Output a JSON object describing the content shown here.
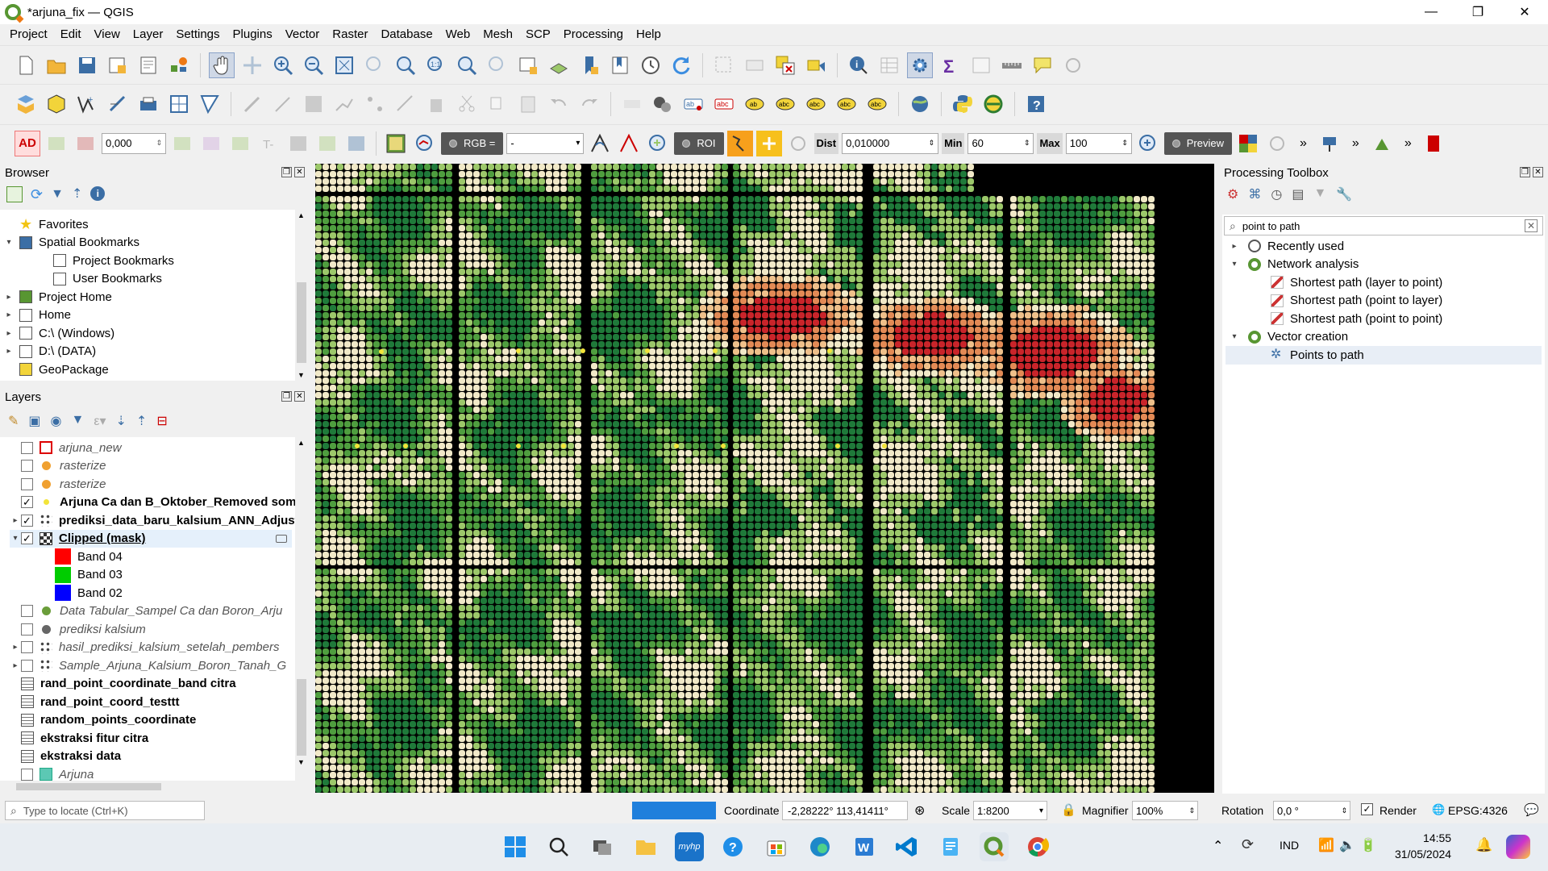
{
  "window": {
    "title": "*arjuna_fix — QGIS",
    "minimize": "—",
    "maximize": "❐",
    "close": "✕"
  },
  "menu": [
    "Project",
    "Edit",
    "View",
    "Layer",
    "Settings",
    "Plugins",
    "Vector",
    "Raster",
    "Database",
    "Web",
    "Mesh",
    "SCP",
    "Processing",
    "Help"
  ],
  "scp_toolbar": {
    "ad": "AD",
    "zero_value": "0,000",
    "rgb_label": "RGB =",
    "rgb_value": "-",
    "roi_label": "ROI",
    "dist_label": "Dist",
    "dist_value": "0,010000",
    "min_label": "Min",
    "min_value": "60",
    "max_label": "Max",
    "max_value": "100",
    "preview_label": "Preview"
  },
  "browser": {
    "title": "Browser",
    "items": [
      {
        "label": "Favorites",
        "icon": "star-icon",
        "expand": ""
      },
      {
        "label": "Spatial Bookmarks",
        "icon": "bookmarks-icon",
        "expand": "▾"
      },
      {
        "label": "Project Bookmarks",
        "icon": "folder-icon",
        "expand": "",
        "indent": 1
      },
      {
        "label": "User Bookmarks",
        "icon": "folder-icon",
        "expand": "",
        "indent": 1
      },
      {
        "label": "Project Home",
        "icon": "project-home-icon",
        "expand": "▸"
      },
      {
        "label": "Home",
        "icon": "home-icon",
        "expand": "▸"
      },
      {
        "label": "C:\\ (Windows)",
        "icon": "drive-icon",
        "expand": "▸"
      },
      {
        "label": "D:\\ (DATA)",
        "icon": "drive-icon",
        "expand": "▸"
      },
      {
        "label": "GeoPackage",
        "icon": "geopackage-icon",
        "expand": ""
      }
    ]
  },
  "layers": {
    "title": "Layers",
    "items": [
      {
        "label": "arjuna_new",
        "style": "ital",
        "checked": false,
        "sym": "red-outline-square",
        "expand": ""
      },
      {
        "label": "rasterize",
        "style": "ital",
        "checked": false,
        "sym": "orange-dot",
        "expand": ""
      },
      {
        "label": "rasterize",
        "style": "ital",
        "checked": false,
        "sym": "orange-dot",
        "expand": ""
      },
      {
        "label": "Arjuna Ca dan B_Oktober_Removed som",
        "style": "bold",
        "checked": true,
        "sym": "yellow-dot",
        "expand": ""
      },
      {
        "label": "prediksi_data_baru_kalsium_ANN_Adjust",
        "style": "bold",
        "checked": true,
        "sym": "points",
        "expand": "▸"
      },
      {
        "label": "Clipped (mask)",
        "style": "bold-u",
        "checked": true,
        "sym": "raster",
        "expand": "▾"
      },
      {
        "label": "Band 04",
        "style": "",
        "sym": "band-red",
        "expand": "",
        "band": true
      },
      {
        "label": "Band 03",
        "style": "",
        "sym": "band-green",
        "expand": "",
        "band": true
      },
      {
        "label": "Band 02",
        "style": "",
        "sym": "band-blue",
        "expand": "",
        "band": true
      },
      {
        "label": "Data Tabular_Sampel Ca dan Boron_Arju",
        "style": "ital",
        "checked": false,
        "sym": "green-dot",
        "expand": ""
      },
      {
        "label": "prediksi kalsium",
        "style": "ital",
        "checked": false,
        "sym": "gray-dot",
        "expand": ""
      },
      {
        "label": "hasil_prediksi_kalsium_setelah_pembers",
        "style": "ital",
        "checked": false,
        "sym": "points",
        "expand": "▸"
      },
      {
        "label": "Sample_Arjuna_Kalsium_Boron_Tanah_G",
        "style": "ital",
        "checked": false,
        "sym": "points",
        "expand": "▸"
      },
      {
        "label": "rand_point_coordinate_band citra",
        "style": "bold",
        "sym": "table",
        "expand": ""
      },
      {
        "label": "rand_point_coord_testtt",
        "style": "bold",
        "sym": "table",
        "expand": ""
      },
      {
        "label": "random_points_coordinate",
        "style": "bold",
        "sym": "table",
        "expand": ""
      },
      {
        "label": "ekstraksi fitur citra",
        "style": "bold",
        "sym": "table",
        "expand": ""
      },
      {
        "label": "ekstraksi data",
        "style": "bold",
        "sym": "table",
        "expand": ""
      },
      {
        "label": "Arjuna",
        "style": "ital",
        "checked": false,
        "sym": "teal-square",
        "expand": ""
      }
    ]
  },
  "processing": {
    "title": "Processing Toolbox",
    "search": "point to path",
    "items": [
      {
        "label": "Recently used",
        "icon": "clock-icon",
        "expand": "▸",
        "indent": 0
      },
      {
        "label": "Network analysis",
        "icon": "qgis-icon",
        "expand": "▾",
        "indent": 0
      },
      {
        "label": "Shortest path (layer to point)",
        "icon": "algorithm-icon",
        "expand": "",
        "indent": 1
      },
      {
        "label": "Shortest path (point to layer)",
        "icon": "algorithm-icon",
        "expand": "",
        "indent": 1
      },
      {
        "label": "Shortest path (point to point)",
        "icon": "algorithm-icon",
        "expand": "",
        "indent": 1
      },
      {
        "label": "Vector creation",
        "icon": "qgis-icon",
        "expand": "▾",
        "indent": 0
      },
      {
        "label": "Points to path",
        "icon": "gear-icon",
        "expand": "",
        "indent": 1,
        "selected": true
      }
    ]
  },
  "status": {
    "locate_placeholder": "Type to locate (Ctrl+K)",
    "coord_label": "Coordinate",
    "coord_value": "-2,28222° 113,41411°",
    "scale_label": "Scale",
    "scale_value": "1:8200",
    "magnifier_label": "Magnifier",
    "magnifier_value": "100%",
    "rotation_label": "Rotation",
    "rotation_value": "0,0 °",
    "render_label": "Render",
    "crs": "EPSG:4326"
  },
  "taskbar": {
    "lang": "IND",
    "time": "14:55",
    "date": "31/05/2024"
  },
  "colors": {
    "dark_green": "#1f7a3a",
    "mid_green": "#4f9e3f",
    "light_green": "#9cc86a",
    "cream": "#f1e9c8",
    "tan": "#efc08a",
    "orange": "#e38a55",
    "red": "#c9242a",
    "accent": "#0078d4"
  }
}
